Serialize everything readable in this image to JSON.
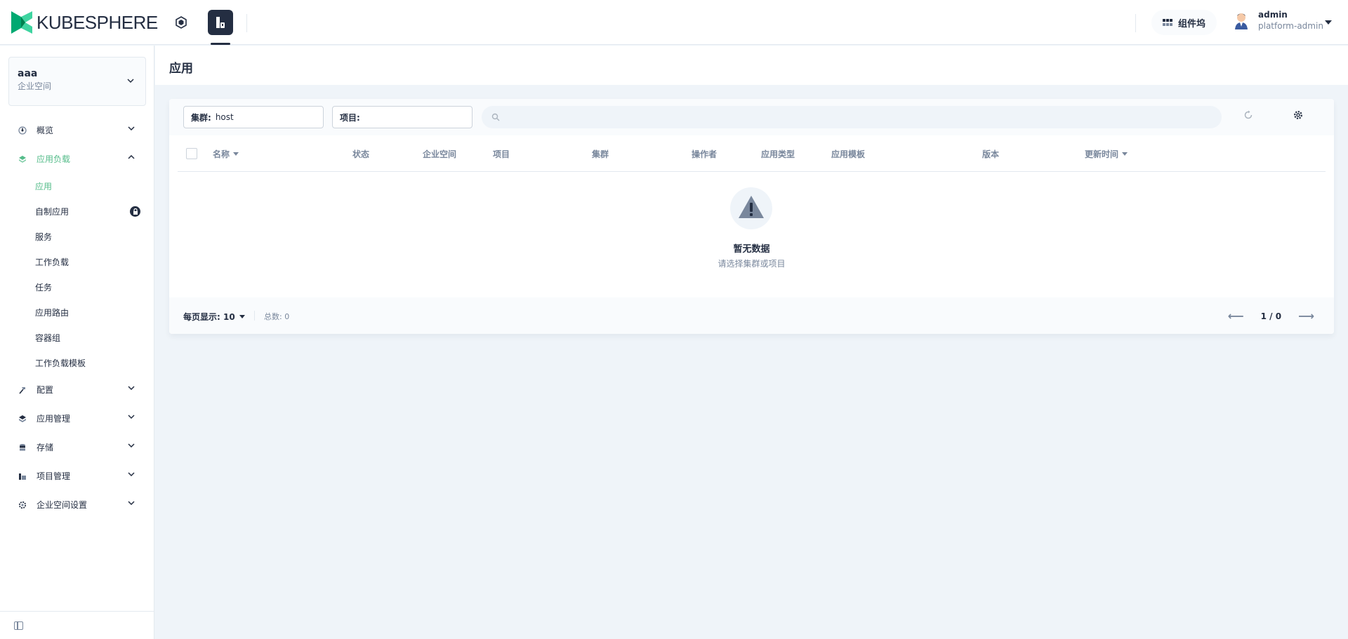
{
  "brand": {
    "name": "KUBESPHERE",
    "accent": "#55bc8a"
  },
  "topbar": {
    "tools_label": "组件坞",
    "user": {
      "name": "admin",
      "role": "platform-admin"
    }
  },
  "workspace": {
    "name": "aaa",
    "type": "企业空间"
  },
  "sidebar": {
    "items": [
      {
        "label": "概览",
        "icon": "dashboard-icon"
      },
      {
        "label": "应用负载",
        "icon": "appstore-icon",
        "expanded": true
      },
      {
        "label": "配置",
        "icon": "hammer-icon"
      },
      {
        "label": "应用管理",
        "icon": "appstore-icon"
      },
      {
        "label": "存储",
        "icon": "database-icon"
      },
      {
        "label": "项目管理",
        "icon": "project-icon"
      },
      {
        "label": "企业空间设置",
        "icon": "gear-icon"
      }
    ],
    "sub_items": [
      {
        "label": "应用",
        "active": true
      },
      {
        "label": "自制应用",
        "locked": true
      },
      {
        "label": "服务"
      },
      {
        "label": "工作负载"
      },
      {
        "label": "任务"
      },
      {
        "label": "应用路由"
      },
      {
        "label": "容器组"
      },
      {
        "label": "工作负载模板"
      }
    ]
  },
  "page": {
    "title": "应用"
  },
  "filters": {
    "cluster_label": "集群:",
    "cluster_value": "host",
    "project_label": "项目:",
    "project_value": "",
    "search_placeholder": ""
  },
  "table": {
    "columns": [
      "名称",
      "状态",
      "企业空间",
      "项目",
      "集群",
      "操作者",
      "应用类型",
      "应用模板",
      "版本",
      "更新时间"
    ]
  },
  "empty": {
    "title": "暂无数据",
    "description": "请选择集群或项目"
  },
  "pagination": {
    "page_size_label": "每页显示: 10",
    "total_label": "总数: 0",
    "page_indicator": "1 / 0"
  }
}
